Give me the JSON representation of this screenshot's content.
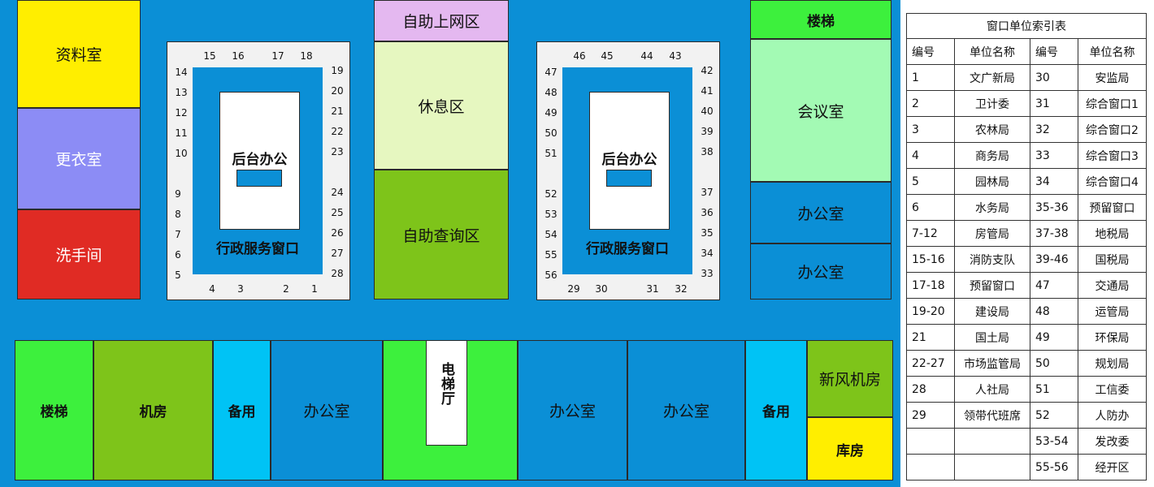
{
  "left_rooms": {
    "archive": "资料室",
    "locker": "更衣室",
    "restroom": "洗手间"
  },
  "middle": {
    "self_internet": "自助上网区",
    "rest_area": "休息区",
    "self_query": "自助查询区"
  },
  "right_rooms": {
    "stairs": "楼梯",
    "meeting_room": "会议室",
    "office_1": "办公室",
    "office_2": "办公室"
  },
  "hall_left": {
    "inner_label": "后台办公",
    "ring_label": "行政服务窗口",
    "top_numbers": [
      "15",
      "16",
      "17",
      "18"
    ],
    "left_numbers": [
      "14",
      "13",
      "12",
      "11",
      "10",
      "9",
      "8",
      "7",
      "6",
      "5"
    ],
    "right_numbers": [
      "19",
      "20",
      "21",
      "22",
      "23",
      "24",
      "25",
      "26",
      "27",
      "28"
    ],
    "bottom_numbers": [
      "4",
      "3",
      "2",
      "1"
    ]
  },
  "hall_right": {
    "inner_label": "后台办公",
    "ring_label": "行政服务窗口",
    "top_numbers": [
      "46",
      "45",
      "44",
      "43"
    ],
    "left_numbers": [
      "47",
      "48",
      "49",
      "50",
      "51",
      "52",
      "53",
      "54",
      "55",
      "56"
    ],
    "right_numbers": [
      "42",
      "41",
      "40",
      "39",
      "38",
      "37",
      "36",
      "35",
      "34",
      "33"
    ],
    "bottom_numbers": [
      "29",
      "30",
      "31",
      "32"
    ]
  },
  "bottom_rooms": {
    "stairs": "楼梯",
    "machine_room": "机房",
    "spare_1": "备用",
    "office_1": "办公室",
    "elevator_hall": "电梯厅",
    "office_2": "办公室",
    "office_3": "办公室",
    "spare_2": "备用",
    "fresh_air_room": "新风机房",
    "warehouse": "库房"
  },
  "index_table": {
    "title": "窗口单位索引表",
    "headers": [
      "编号",
      "单位名称",
      "编号",
      "单位名称"
    ],
    "rows": [
      [
        "1",
        "文广新局",
        "30",
        "安监局"
      ],
      [
        "2",
        "卫计委",
        "31",
        "综合窗口1"
      ],
      [
        "3",
        "农林局",
        "32",
        "综合窗口2"
      ],
      [
        "4",
        "商务局",
        "33",
        "综合窗口3"
      ],
      [
        "5",
        "园林局",
        "34",
        "综合窗口4"
      ],
      [
        "6",
        "水务局",
        "35-36",
        "预留窗口"
      ],
      [
        "7-12",
        "房管局",
        "37-38",
        "地税局"
      ],
      [
        "15-16",
        "消防支队",
        "39-46",
        "国税局"
      ],
      [
        "17-18",
        "预留窗口",
        "47",
        "交通局"
      ],
      [
        "19-20",
        "建设局",
        "48",
        "运管局"
      ],
      [
        "21",
        "国土局",
        "49",
        "环保局"
      ],
      [
        "22-27",
        "市场监管局",
        "50",
        "规划局"
      ],
      [
        "28",
        "人社局",
        "51",
        "工信委"
      ],
      [
        "29",
        "领带代班席",
        "52",
        "人防办"
      ],
      [
        "",
        "",
        "53-54",
        "发改委"
      ],
      [
        "",
        "",
        "55-56",
        "经开区"
      ]
    ]
  },
  "colors": {
    "floor_blue": "#0b8fd6",
    "yellow": "#ffee00",
    "periwinkle": "#8c8cf5",
    "red": "#e02b24",
    "lavender": "#e4b8f0",
    "pale_green": "#e6f7c0",
    "olive_green": "#7ec41a",
    "bright_green": "#3df03d",
    "mint": "#a3fab4",
    "cyan": "#00c3f5"
  }
}
